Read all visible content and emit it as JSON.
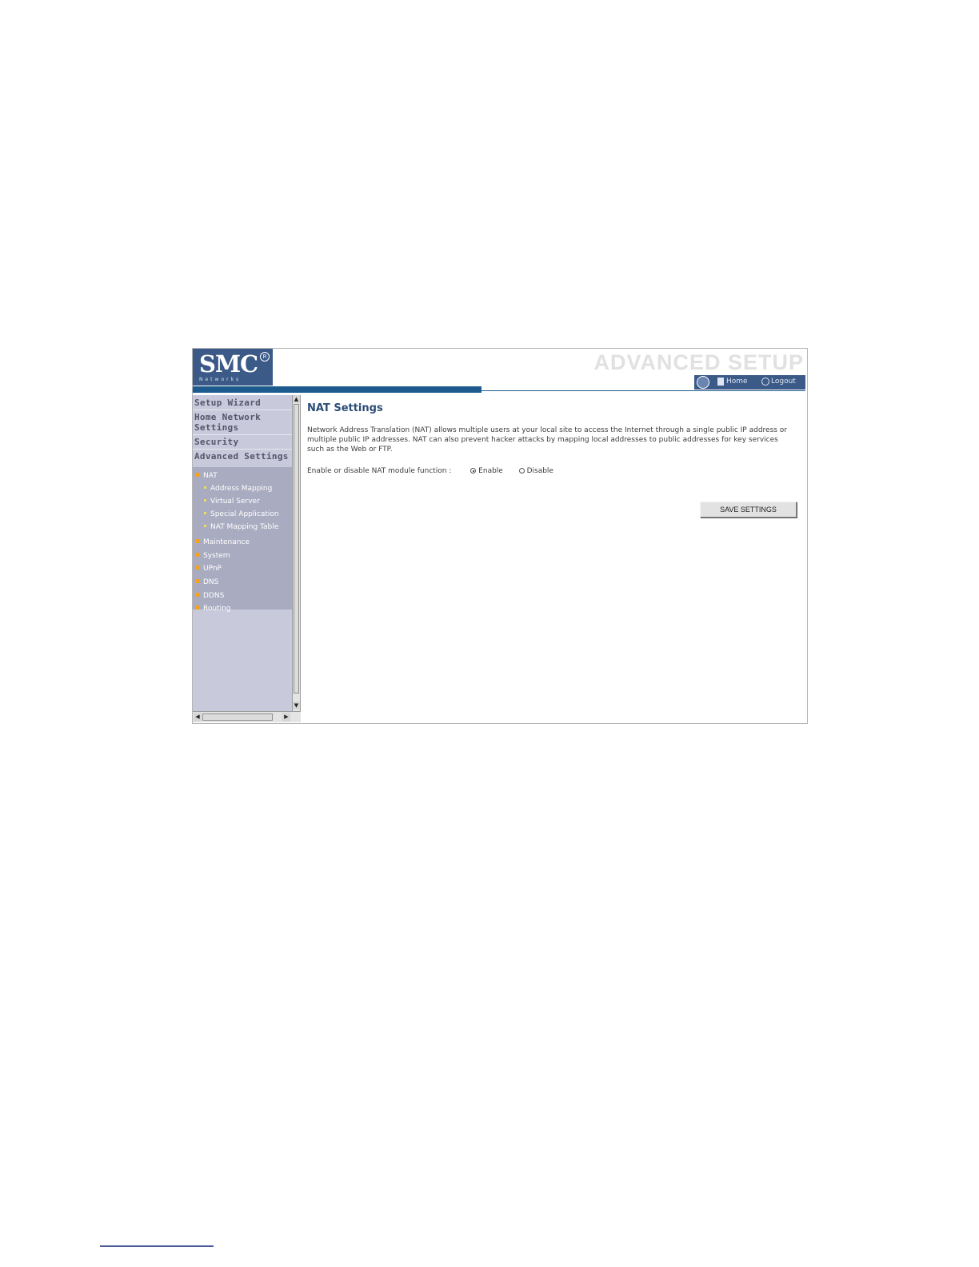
{
  "header": {
    "logo_text": "SMC",
    "logo_reg": "R",
    "logo_sub": "Networks",
    "title": "ADVANCED SETUP",
    "home_label": "Home",
    "logout_label": "Logout"
  },
  "sidebar": {
    "top_items": [
      {
        "label": "Setup Wizard"
      },
      {
        "label": "Home Network Settings"
      },
      {
        "label": "Security"
      },
      {
        "label": "Advanced Settings"
      }
    ],
    "nav": [
      {
        "label": "NAT",
        "children": [
          "Address Mapping",
          "Virtual Server",
          "Special Application",
          "NAT Mapping Table"
        ]
      },
      {
        "label": "Maintenance"
      },
      {
        "label": "System"
      },
      {
        "label": "UPnP"
      },
      {
        "label": "DNS"
      },
      {
        "label": "DDNS"
      },
      {
        "label": "Routing"
      }
    ]
  },
  "main": {
    "title": "NAT Settings",
    "description": "Network Address Translation (NAT) allows multiple users at your local site to access the Internet through a single public IP address or multiple public IP addresses. NAT can also prevent hacker attacks by mapping local addresses to public addresses for key services such as the Web or FTP.",
    "nat_label": "Enable or disable NAT module function :",
    "enable_label": "Enable",
    "disable_label": "Disable",
    "selected": "Enable",
    "save_label": "SAVE SETTINGS"
  },
  "colors": {
    "brand": "#3b5a87",
    "accent_bar": "#1d5b8f",
    "sidebar": "#c8c9db",
    "nav_bg": "#a9abc1",
    "title_text": "#2d4d77"
  },
  "icons": {
    "toolbar": [
      "globe-icon",
      "home-icon",
      "logout-icon"
    ],
    "scroll": [
      "arrow-up-icon",
      "arrow-down-icon",
      "arrow-left-icon",
      "arrow-right-icon"
    ]
  }
}
